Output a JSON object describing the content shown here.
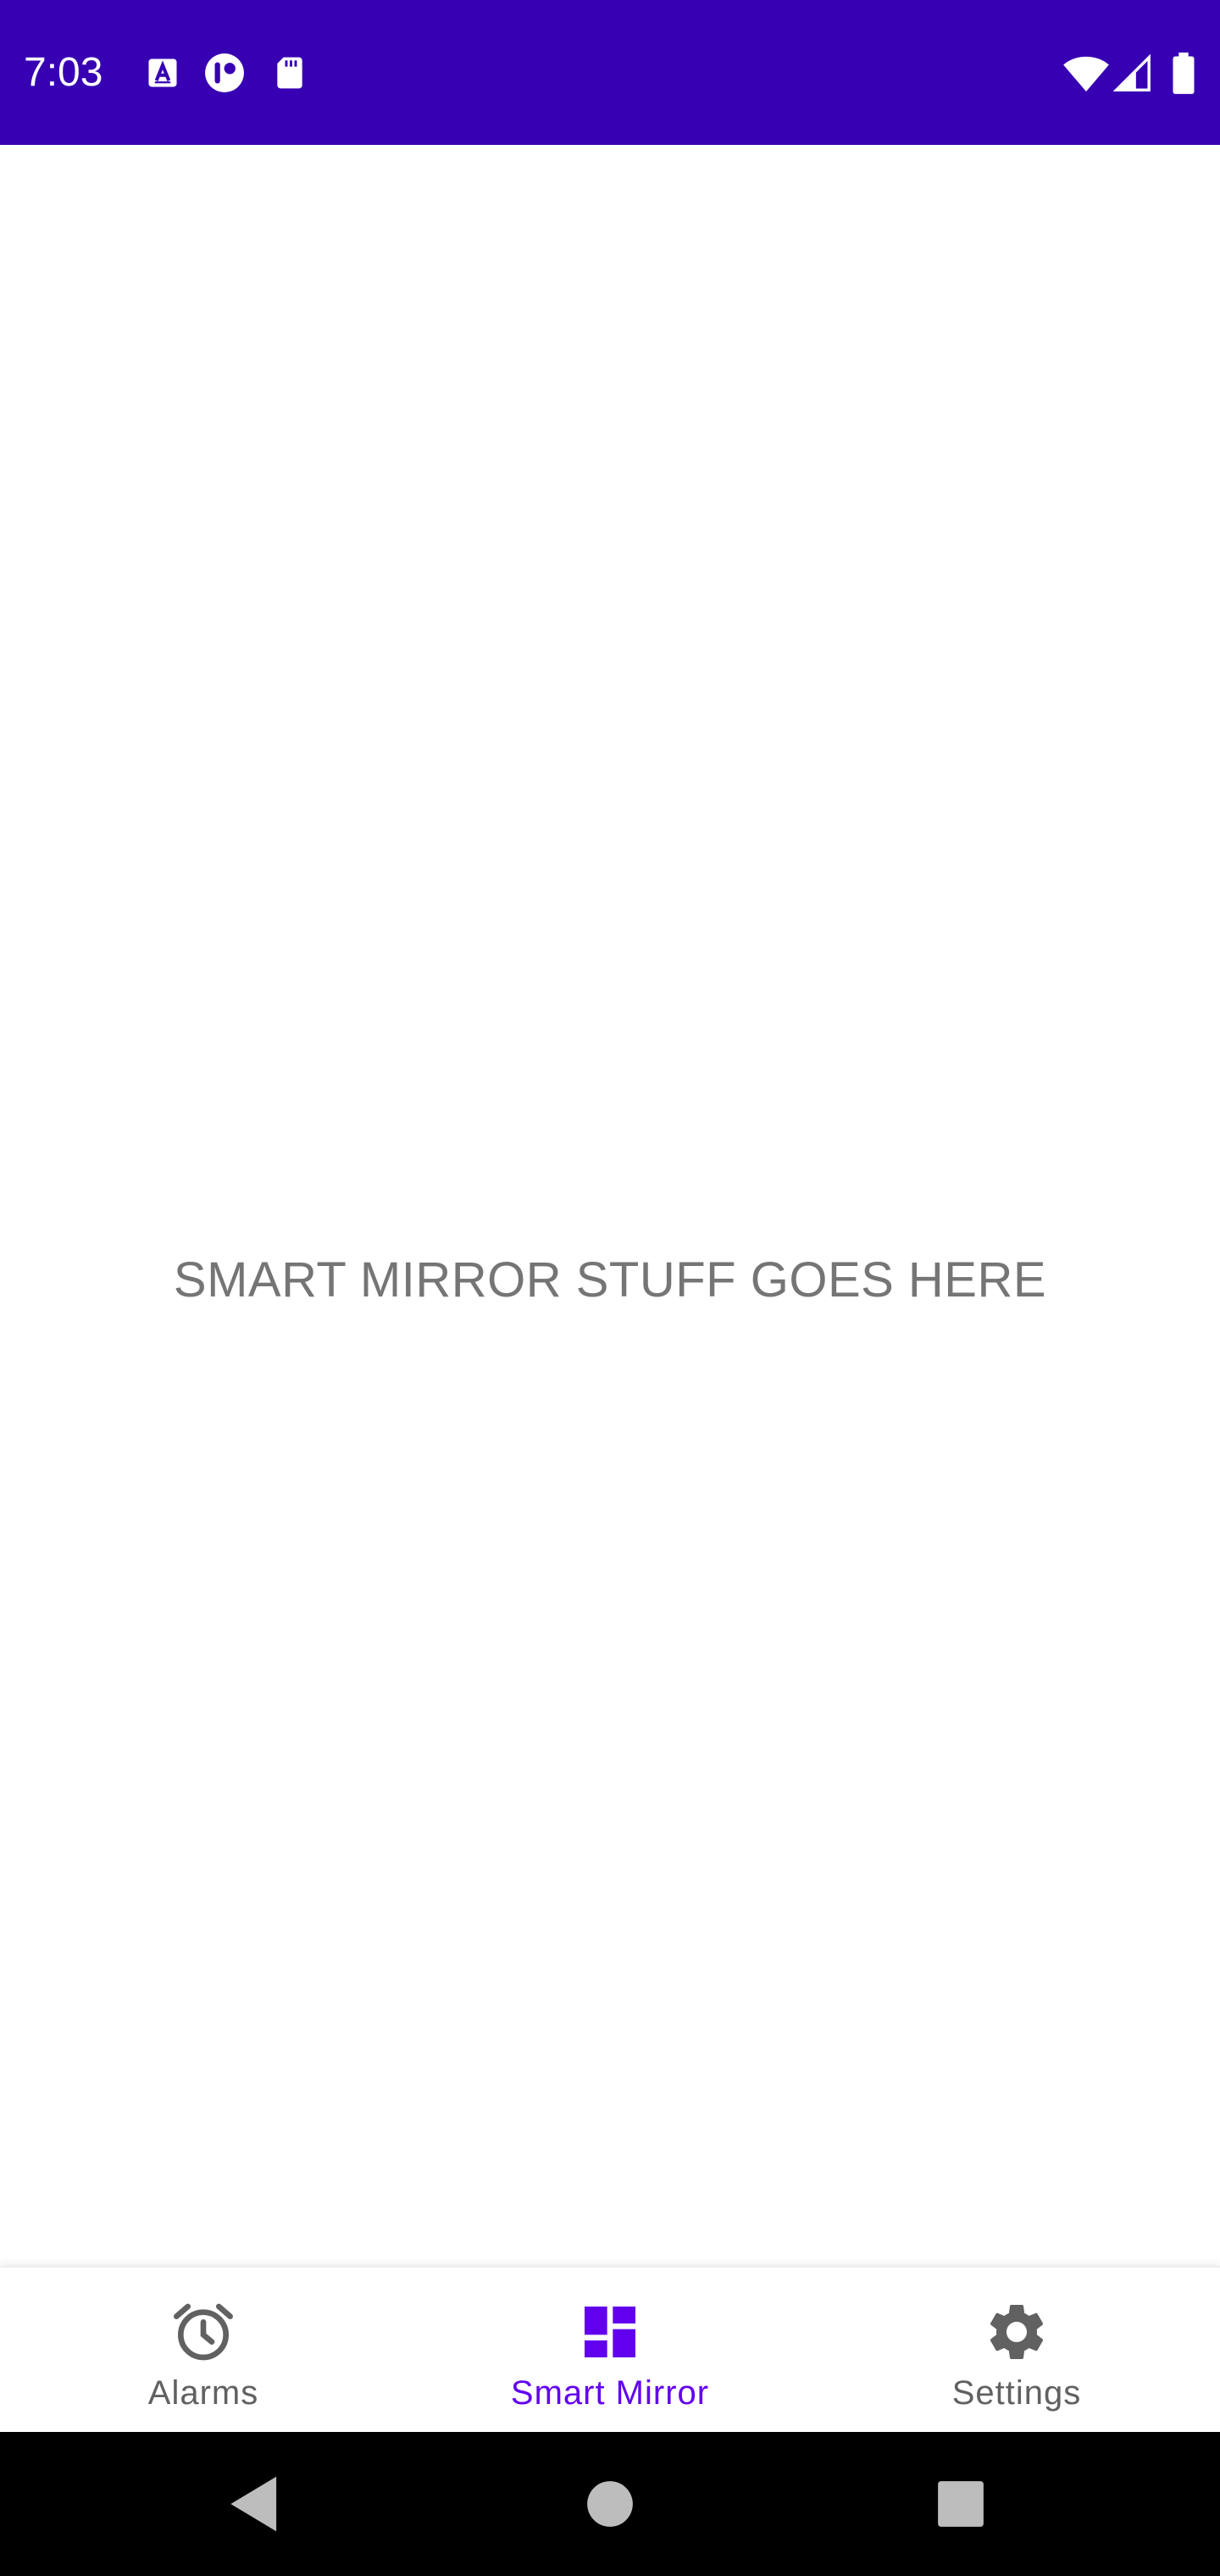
{
  "status_bar": {
    "time": "7:03",
    "background": "#3700B3",
    "left_icons": [
      "app-a-icon",
      "notification-circle-icon",
      "sd-card-icon"
    ],
    "right_icons": [
      "wifi-icon",
      "cellular-signal-icon",
      "battery-icon"
    ]
  },
  "main": {
    "placeholder_text": "SMART MIRROR STUFF GOES HERE"
  },
  "bottom_nav": {
    "active_color": "#6200EE",
    "inactive_color": "#616161",
    "items": [
      {
        "label": "Alarms",
        "icon": "alarm-clock-icon",
        "active": false
      },
      {
        "label": "Smart Mirror",
        "icon": "dashboard-icon",
        "active": true
      },
      {
        "label": "Settings",
        "icon": "gear-icon",
        "active": false
      }
    ]
  },
  "system_nav": {
    "buttons": [
      "back-icon",
      "home-icon",
      "recents-icon"
    ]
  }
}
